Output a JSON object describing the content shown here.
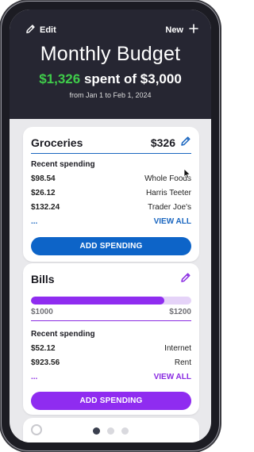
{
  "header": {
    "edit_label": "Edit",
    "new_label": "New",
    "title": "Monthly Budget",
    "spent_amount": "$1,326",
    "spent_text": "spent of $3,000",
    "date_range": "from Jan 1 to Feb 1, 2024"
  },
  "groceries": {
    "title": "Groceries",
    "amount": "$326",
    "recent_label": "Recent spending",
    "rows": [
      {
        "amount": "$98.54",
        "merchant": "Whole Foods"
      },
      {
        "amount": "$26.12",
        "merchant": "Harris Teeter"
      },
      {
        "amount": "$132.24",
        "merchant": "Trader Joe's"
      }
    ],
    "more": "...",
    "view_all": "VIEW ALL",
    "add_label": "ADD SPENDING"
  },
  "bills": {
    "title": "Bills",
    "spent": "$1000",
    "limit": "$1200",
    "progress_fraction": 0.833,
    "recent_label": "Recent spending",
    "rows": [
      {
        "amount": "$52.12",
        "merchant": "Internet"
      },
      {
        "amount": "$923.56",
        "merchant": "Rent"
      }
    ],
    "more": "...",
    "view_all": "VIEW ALL",
    "add_label": "ADD SPENDING"
  },
  "pager": {
    "pages": 3,
    "active": 0
  },
  "icons": {
    "edit": "pencil-icon",
    "new": "plus-icon",
    "groceries_edit": "pencil-icon",
    "bills_edit": "pencil-icon"
  },
  "colors": {
    "header_bg": "#262632",
    "spent_green": "#3fcc4a",
    "groceries_accent": "#0d64c8",
    "bills_accent": "#8f2cf0"
  }
}
